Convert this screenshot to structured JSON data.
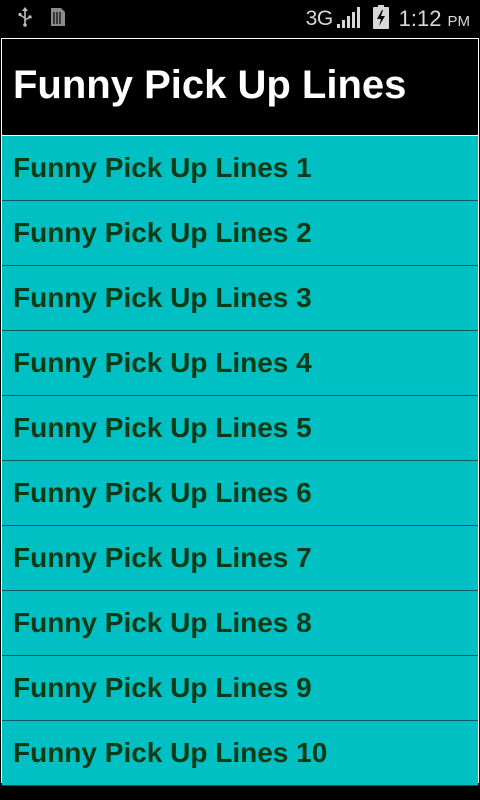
{
  "status_bar": {
    "network": "3G",
    "time": "1:12",
    "ampm": "PM",
    "icons": [
      "usb-icon",
      "sim-card-icon",
      "signal-icon",
      "battery-charging-icon"
    ]
  },
  "app": {
    "title": "Funny Pick Up Lines"
  },
  "list": {
    "items": [
      {
        "label": "Funny Pick Up Lines 1"
      },
      {
        "label": "Funny Pick Up Lines 2"
      },
      {
        "label": "Funny Pick Up Lines 3"
      },
      {
        "label": "Funny Pick Up Lines 4"
      },
      {
        "label": "Funny Pick Up Lines 5"
      },
      {
        "label": "Funny Pick Up Lines 6"
      },
      {
        "label": "Funny Pick Up Lines 7"
      },
      {
        "label": "Funny Pick Up Lines 8"
      },
      {
        "label": "Funny Pick Up Lines 9"
      },
      {
        "label": "Funny Pick Up Lines 10"
      }
    ]
  },
  "colors": {
    "row_background": "#00c0c4",
    "row_text": "#0b3a14",
    "title_background": "#000000",
    "title_text": "#ffffff"
  }
}
